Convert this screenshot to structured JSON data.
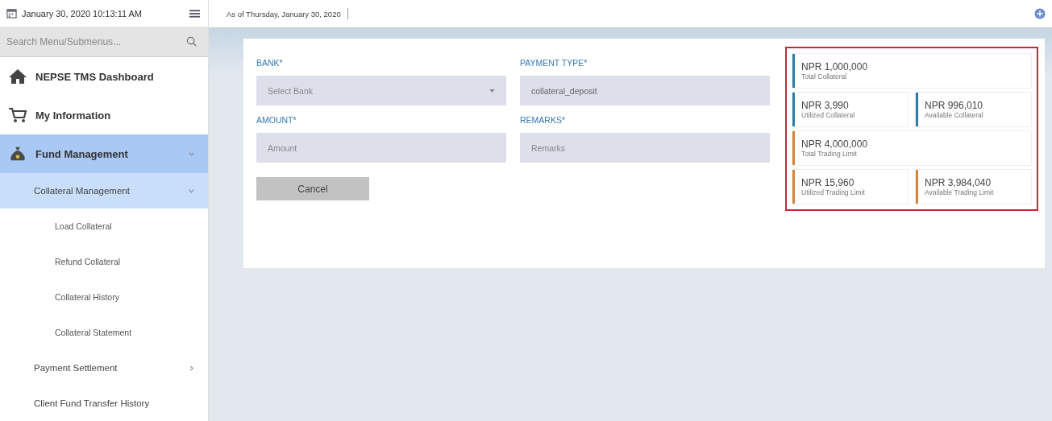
{
  "clock": "January 30, 2020 10:13:11 AM",
  "search": {
    "placeholder": "Search Menu/Submenus..."
  },
  "menu": [
    {
      "label": "NEPSE TMS Dashboard",
      "selected": false
    },
    {
      "label": "My Information",
      "selected": false
    },
    {
      "label": "Fund Management",
      "selected": true,
      "expanded": true,
      "children": [
        {
          "label": "Collateral Management",
          "selected": true,
          "expanded": true,
          "children": [
            {
              "label": "Load Collateral",
              "selected": false
            },
            {
              "label": "Refund Collateral",
              "selected": false
            },
            {
              "label": "Collateral History",
              "selected": false
            },
            {
              "label": "Collateral Statement",
              "selected": false
            }
          ]
        },
        {
          "label": "Payment Settlement",
          "selected": false,
          "expanded": false
        },
        {
          "label": "Client Fund Transfer History",
          "selected": false
        }
      ]
    }
  ],
  "as_of": "As of Thursday, January 30, 2020",
  "form": {
    "fields": [
      {
        "label": "BANK*",
        "kind": "select",
        "placeholder": "Select Bank"
      },
      {
        "label": "PAYMENT TYPE*",
        "kind": "text",
        "value": "collateral_deposit"
      },
      {
        "label": "AMOUNT*",
        "kind": "text",
        "placeholder": "Amount"
      },
      {
        "label": "REMARKS*",
        "kind": "text",
        "placeholder": "Remarks"
      }
    ],
    "buttons": [
      "Cancel"
    ]
  },
  "summary": {
    "rows": [
      [
        {
          "amount": "NPR 1,000,000",
          "label": "Total Collateral",
          "color": "#2e7ca8"
        }
      ],
      [
        {
          "amount": "NPR 3,990",
          "label": "Utilized Collateral",
          "color": "#2e7ca8"
        },
        {
          "amount": "NPR 996,010",
          "label": "Available Collateral",
          "color": "#2e7ca8"
        }
      ],
      [
        {
          "amount": "NPR 4,000,000",
          "label": "Total Trading Limit",
          "color": "#d9843a"
        }
      ],
      [
        {
          "amount": "NPR 15,960",
          "label": "Utilized Trading Limit",
          "color": "#d9843a"
        },
        {
          "amount": "NPR 3,984,040",
          "label": "Available Trading Limit",
          "color": "#d9843a"
        }
      ]
    ]
  }
}
